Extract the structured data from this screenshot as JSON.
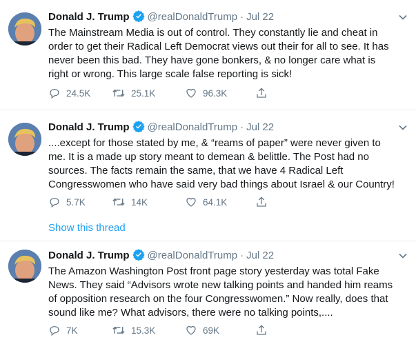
{
  "tweets": [
    {
      "name": "Donald J. Trump",
      "handle": "@realDonaldTrump",
      "sep": "·",
      "date": "Jul 22",
      "text": "The Mainstream Media is out of control. They constantly lie and cheat in\norder to get their Radical Left Democrat views out their for all to see. It has\nnever been this bad. They have gone bonkers, & no longer care what is\nright or wrong. This large scale false reporting is sick!",
      "replies": "24.5K",
      "retweets": "25.1K",
      "likes": "96.3K"
    },
    {
      "name": "Donald J. Trump",
      "handle": "@realDonaldTrump",
      "sep": "·",
      "date": "Jul 22",
      "text": "....except for those stated by me, & “reams of paper” were never given to\nme. It is a made up story meant to demean & belittle. The Post had no\nsources. The facts remain the same, that we have 4 Radical Left\nCongresswomen who have said very bad things about Israel & our Country!",
      "replies": "5.7K",
      "retweets": "14K",
      "likes": "64.1K",
      "thread_link": "Show this thread"
    },
    {
      "name": "Donald J. Trump",
      "handle": "@realDonaldTrump",
      "sep": "·",
      "date": "Jul 22",
      "text": "The Amazon Washington Post front page story yesterday was total Fake\nNews. They said “Advisors wrote new talking points and handed him reams\nof opposition research on the four Congresswomen.” Now really, does that\nsound like me? What advisors, there were no talking points,....",
      "replies": "7K",
      "retweets": "15.3K",
      "likes": "69K"
    }
  ],
  "colors": {
    "text": "#14171a",
    "muted": "#657786",
    "link": "#1da1f2",
    "verified": "#1da1f2",
    "divider": "#e6ecf0"
  },
  "icons": {
    "reply": "reply-icon",
    "retweet": "retweet-icon",
    "like": "like-icon",
    "share": "share-icon",
    "verified": "verified-badge-icon",
    "more": "chevron-down-icon"
  }
}
